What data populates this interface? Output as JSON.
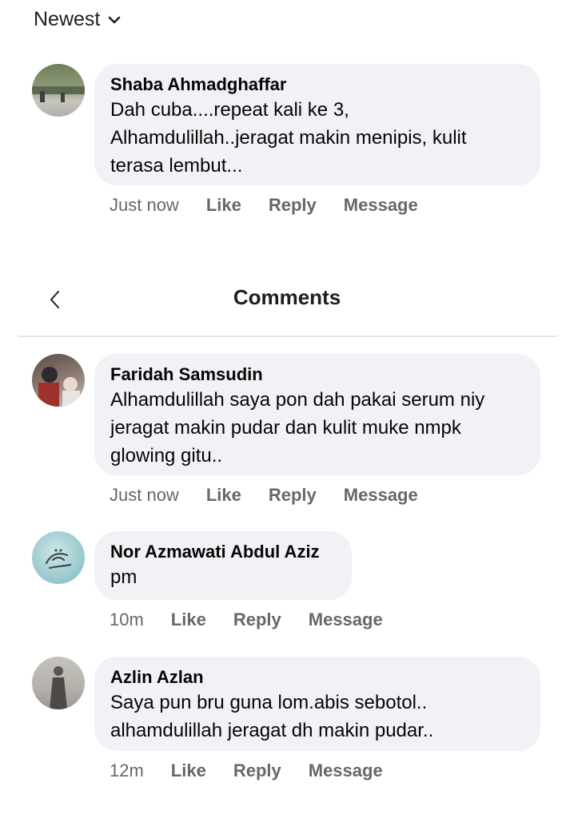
{
  "sort": {
    "label": "Newest",
    "icon": "chevron-down-icon"
  },
  "header": {
    "title": "Comments",
    "back_icon": "chevron-left-icon"
  },
  "comments": [
    {
      "name": "Shaba Ahmadghaffar",
      "text": "Dah cuba....repeat kali ke 3,\nAlhamdulillah..jeragat makin menipis, kulit\nterasa lembut...",
      "time": "Just now",
      "like": "Like",
      "reply": "Reply",
      "message": "Message"
    },
    {
      "name": "Faridah Samsudin",
      "text": "Alhamdulillah saya pon dah pakai serum niy\njeragat makin pudar dan kulit muke nmpk\nglowing gitu..",
      "time": "Just now",
      "like": "Like",
      "reply": "Reply",
      "message": "Message"
    },
    {
      "name": "Nor Azmawati Abdul Aziz",
      "text": "pm",
      "time": "10m",
      "like": "Like",
      "reply": "Reply",
      "message": "Message"
    },
    {
      "name": "Azlin Azlan",
      "text": "Saya pun bru guna lom.abis sebotol..\nalhamdulillah jeragat dh makin pudar..",
      "time": "12m",
      "like": "Like",
      "reply": "Reply",
      "message": "Message"
    }
  ],
  "colors": {
    "bubble": "#f0f2f5",
    "meta": "#65676b",
    "text": "#050505"
  }
}
